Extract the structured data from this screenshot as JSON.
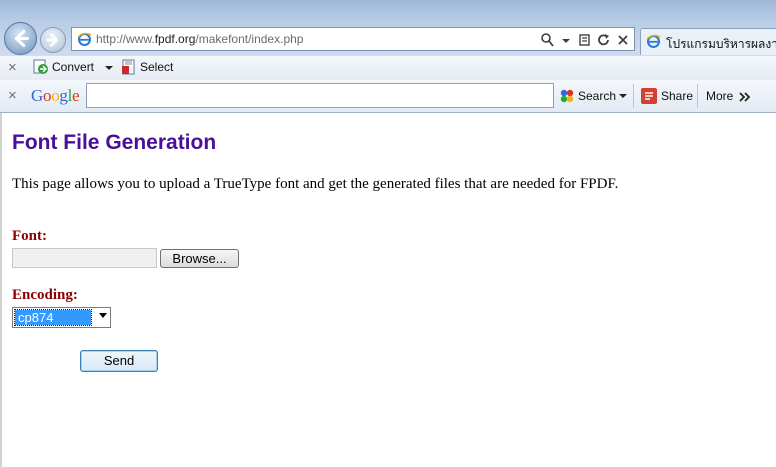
{
  "browser": {
    "address_url_prefix": "http://www.",
    "address_url_domain": "fpdf.org",
    "address_url_path": "/makefont/index.php",
    "tab_title": "โปรแกรมบริหารผลงานแ",
    "icons": [
      "back-arrow-icon",
      "forward-arrow-icon",
      "ie-page-icon",
      "search-icon",
      "compatibility-icon",
      "refresh-icon",
      "stop-icon"
    ]
  },
  "toolbar1": {
    "convert_label": "Convert",
    "select_label": "Select"
  },
  "toolbar2": {
    "google_letters": [
      "G",
      "o",
      "o",
      "g",
      "l",
      "e"
    ],
    "search_value": "",
    "search_label": "Search",
    "share_label": "Share",
    "more_label": "More"
  },
  "page": {
    "title": "Font File Generation",
    "intro": "This page allows you to upload a TrueType font and get the generated files that are needed for FPDF.",
    "font_label": "Font:",
    "browse_label": "Browse...",
    "encoding_label": "Encoding:",
    "encoding_value": "cp874",
    "send_label": "Send"
  },
  "colors": {
    "title": "#4a0f9a",
    "field_label": "#8b0000",
    "select_highlight": "#3399ff"
  }
}
